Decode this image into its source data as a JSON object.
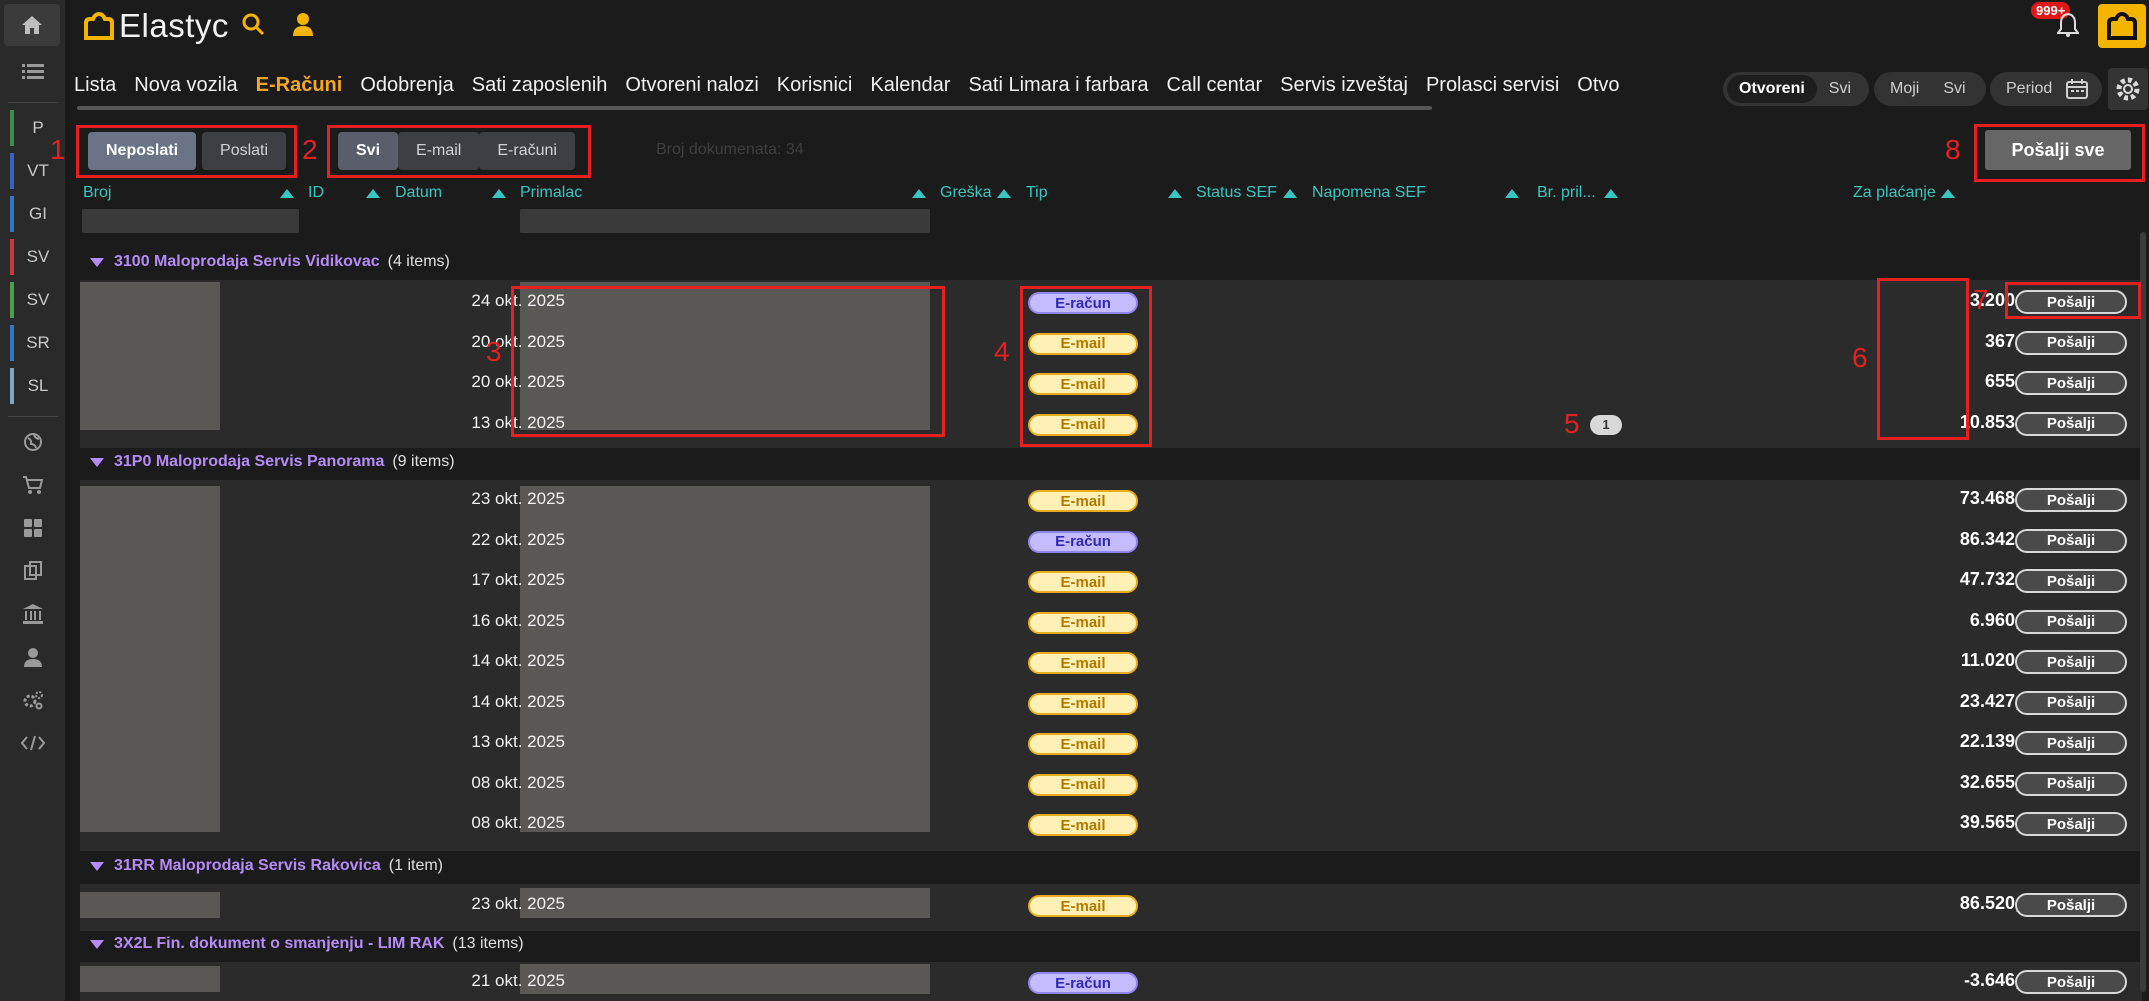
{
  "app": {
    "title": "Elastyc",
    "notifications": "999+"
  },
  "rail": {
    "modules": [
      "P",
      "VT",
      "GI",
      "SV",
      "SV",
      "SR",
      "SL"
    ],
    "module_colors": [
      "#3a8f4f",
      "#3463c8",
      "#2f78c8",
      "#c83a3a",
      "#4aa04a",
      "#2f78c8",
      "#7fa6c8"
    ]
  },
  "nav": {
    "items": [
      "Lista",
      "Nova vozila",
      "E-Računi",
      "Odobrenja",
      "Sati zaposlenih",
      "Otvoreni nalozi",
      "Korisnici",
      "Kalendar",
      "Sati Limara i farbara",
      "Call centar",
      "Servis izveštaj",
      "Prolasci servisi",
      "Otvo"
    ],
    "active_index": 2
  },
  "filters": {
    "status": {
      "options": [
        "Otvoreni",
        "Svi"
      ],
      "selected": "Otvoreni"
    },
    "owner": {
      "options": [
        "Moji",
        "Svi"
      ]
    },
    "period_label": "Period"
  },
  "toolbar": {
    "send_state": {
      "options": [
        "Neposlati",
        "Poslati"
      ],
      "selected": "Neposlati"
    },
    "doc_type": {
      "options": [
        "Svi",
        "E-mail",
        "E-računi"
      ],
      "selected": "Svi"
    },
    "doc_count": "Broj dokumenata: 34",
    "send_all_label": "Pošalji sve"
  },
  "annotations": [
    "1",
    "2",
    "3",
    "4",
    "5",
    "6",
    "7",
    "8"
  ],
  "columns": [
    "Broj",
    "ID",
    "Datum",
    "Primalac",
    "Greška",
    "Tip",
    "Status SEF",
    "Napomena SEF",
    "Br. pril...",
    "Za plaćanje"
  ],
  "send_label": "Pošalji",
  "groups": [
    {
      "name": "3100 Maloprodaja Servis Vidikovac",
      "count": "(4 items)",
      "rows": [
        {
          "date": "24 okt. 2025",
          "type": "E-račun",
          "amount": "3.200,30"
        },
        {
          "date": "20 okt. 2025",
          "type": "E-mail",
          "amount": "367,57"
        },
        {
          "date": "20 okt. 2025",
          "type": "E-mail",
          "amount": "655,38"
        },
        {
          "date": "13 okt. 2025",
          "type": "E-mail",
          "amount": "10.853,65",
          "attachments": "1"
        }
      ]
    },
    {
      "name": "31P0 Maloprodaja Servis Panorama",
      "count": "(9 items)",
      "rows": [
        {
          "date": "23 okt. 2025",
          "type": "E-mail",
          "amount": "73.468,39"
        },
        {
          "date": "22 okt. 2025",
          "type": "E-račun",
          "amount": "86.342,93"
        },
        {
          "date": "17 okt. 2025",
          "type": "E-mail",
          "amount": "47.732,50"
        },
        {
          "date": "16 okt. 2025",
          "type": "E-mail",
          "amount": "6.960,00"
        },
        {
          "date": "14 okt. 2025",
          "type": "E-mail",
          "amount": "11.020,01"
        },
        {
          "date": "14 okt. 2025",
          "type": "E-mail",
          "amount": "23.427,98"
        },
        {
          "date": "13 okt. 2025",
          "type": "E-mail",
          "amount": "22.139,63"
        },
        {
          "date": "08 okt. 2025",
          "type": "E-mail",
          "amount": "32.655,00"
        },
        {
          "date": "08 okt. 2025",
          "type": "E-mail",
          "amount": "39.565,00"
        }
      ]
    },
    {
      "name": "31RR Maloprodaja Servis Rakovica",
      "count": "(1 item)",
      "rows": [
        {
          "date": "23 okt. 2025",
          "type": "E-mail",
          "amount": "86.520,14"
        }
      ]
    },
    {
      "name": "3X2L Fin. dokument o smanjenju - LIM RAK",
      "count": "(13 items)",
      "rows": [
        {
          "date": "21 okt. 2025",
          "type": "E-račun",
          "amount": "-3.646,48"
        }
      ]
    }
  ]
}
